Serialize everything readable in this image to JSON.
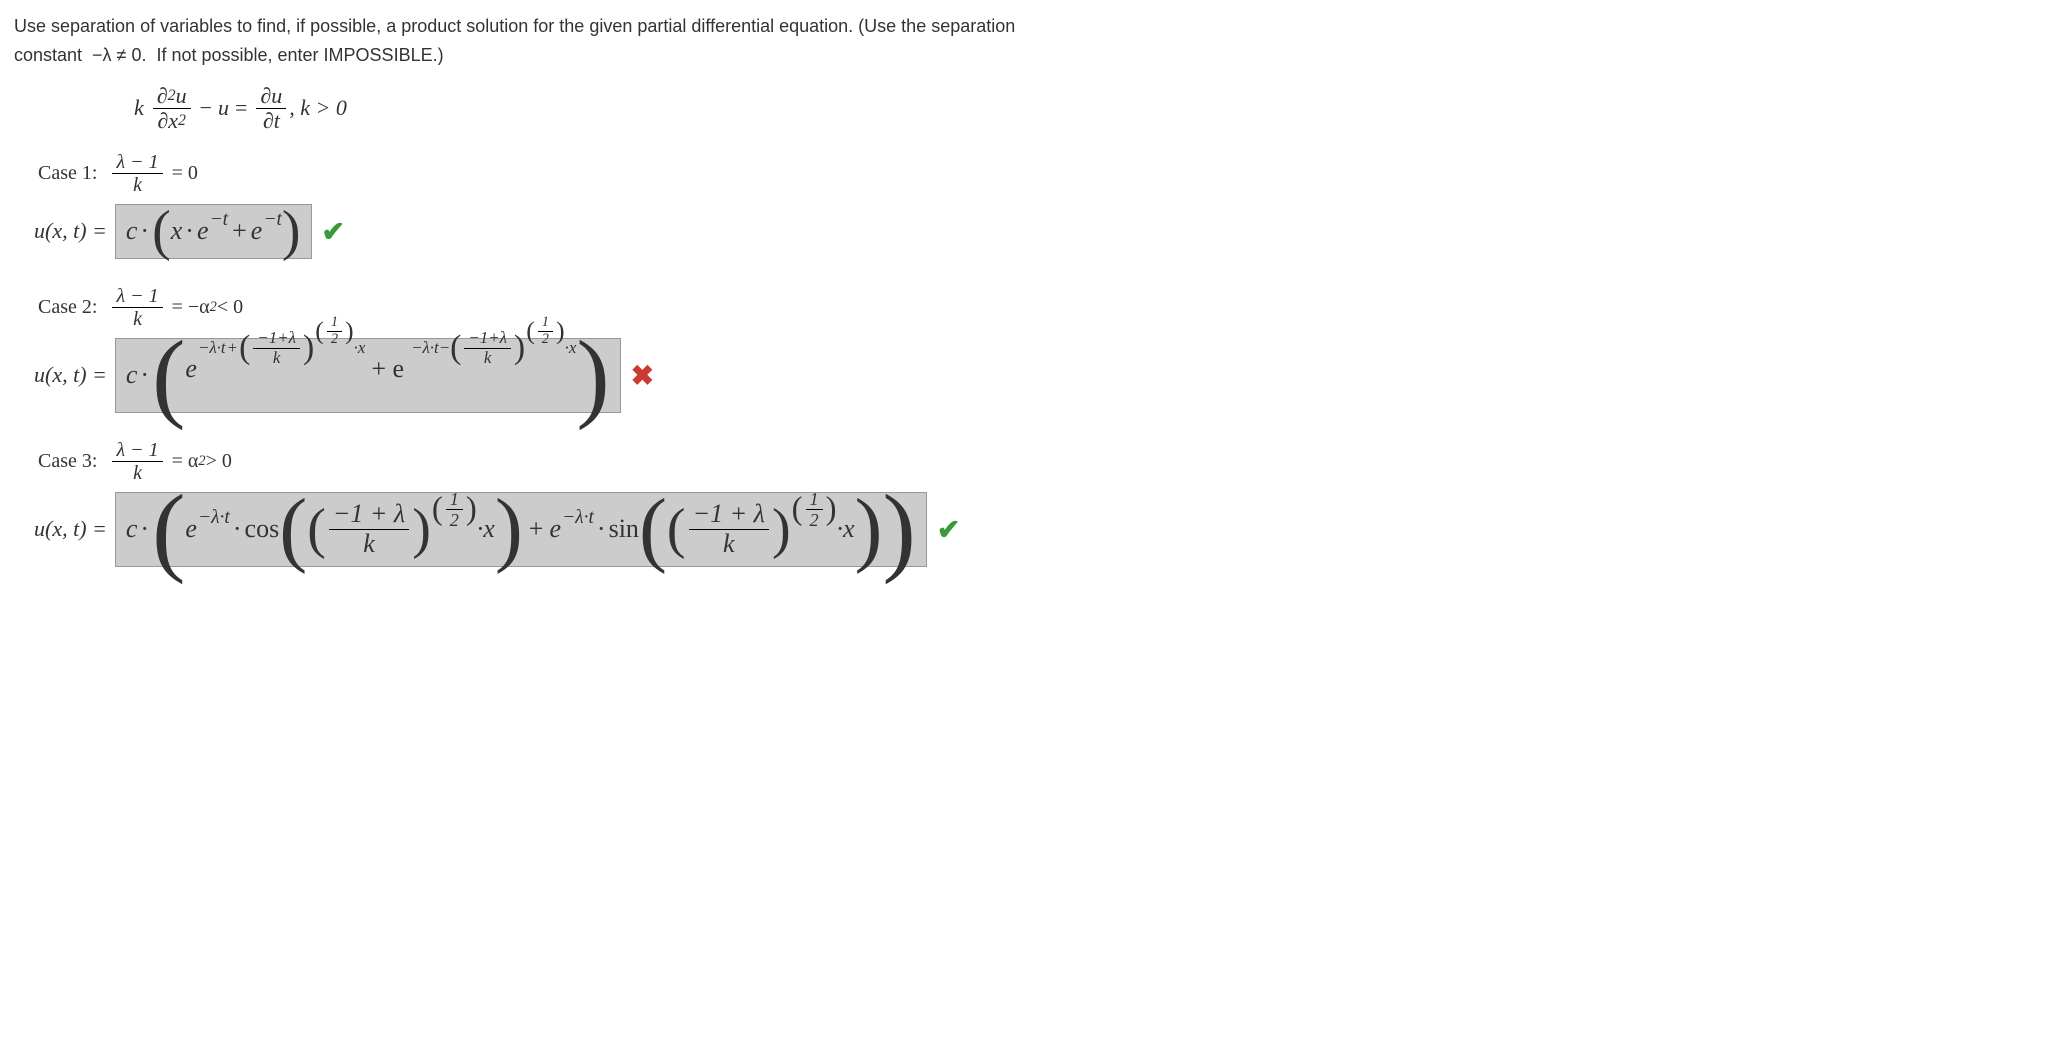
{
  "prompt": {
    "line1": "Use separation of variables to find, if possible, a product solution for the given partial differential equation. (Use the separation",
    "line2": "constant  −λ ≠ 0.  If not possible, enter IMPOSSIBLE.)"
  },
  "pde": {
    "lhs_k": "k",
    "d2u": "∂",
    "u": "u",
    "sq": "2",
    "dx2": "∂x",
    "minus": "−",
    "eq": "=",
    "du": "∂u",
    "dt": "∂t",
    "cond": ", k > 0"
  },
  "cases": {
    "c1_label": "Case 1:",
    "c1_cond_eq": "= 0",
    "c2_label": "Case 2:",
    "c2_cond_eq": "= −α",
    "c2_cond_tail": " < 0",
    "c3_label": "Case 3:",
    "c3_cond_eq": "= α",
    "c3_cond_tail": " > 0",
    "frac_num": "λ − 1",
    "frac_den": "k"
  },
  "uxt_prefix": "u(x, t) = ",
  "ans": {
    "c1": {
      "c": "c",
      "body_a": "x",
      "body_b": "e",
      "exp1": "−t",
      "plus": "+",
      "body_c": "e",
      "exp2": "−t"
    },
    "c2": {
      "c": "c",
      "e": "e",
      "neg_lt": "−λ·t",
      "plus": "+",
      "core_num": "−1+λ",
      "core_den": "k",
      "half_num": "1",
      "half_den": "2",
      "dotx": "·x",
      "mid_plus": "+ e",
      "neg_lt_minus": "−λ·t−"
    },
    "c3": {
      "c": "c",
      "e": "e",
      "neg_lt": "−λ·t",
      "cos": "cos",
      "sin": "sin",
      "core_num": "−1 + λ",
      "core_den": "k",
      "half_num": "1",
      "half_den": "2",
      "dotx": "·x",
      "plus": "+"
    }
  },
  "marks": {
    "c1": "correct",
    "c2": "wrong",
    "c3": "correct"
  },
  "glyphs": {
    "check": "✔",
    "cross": "✖",
    "dot": "·"
  }
}
